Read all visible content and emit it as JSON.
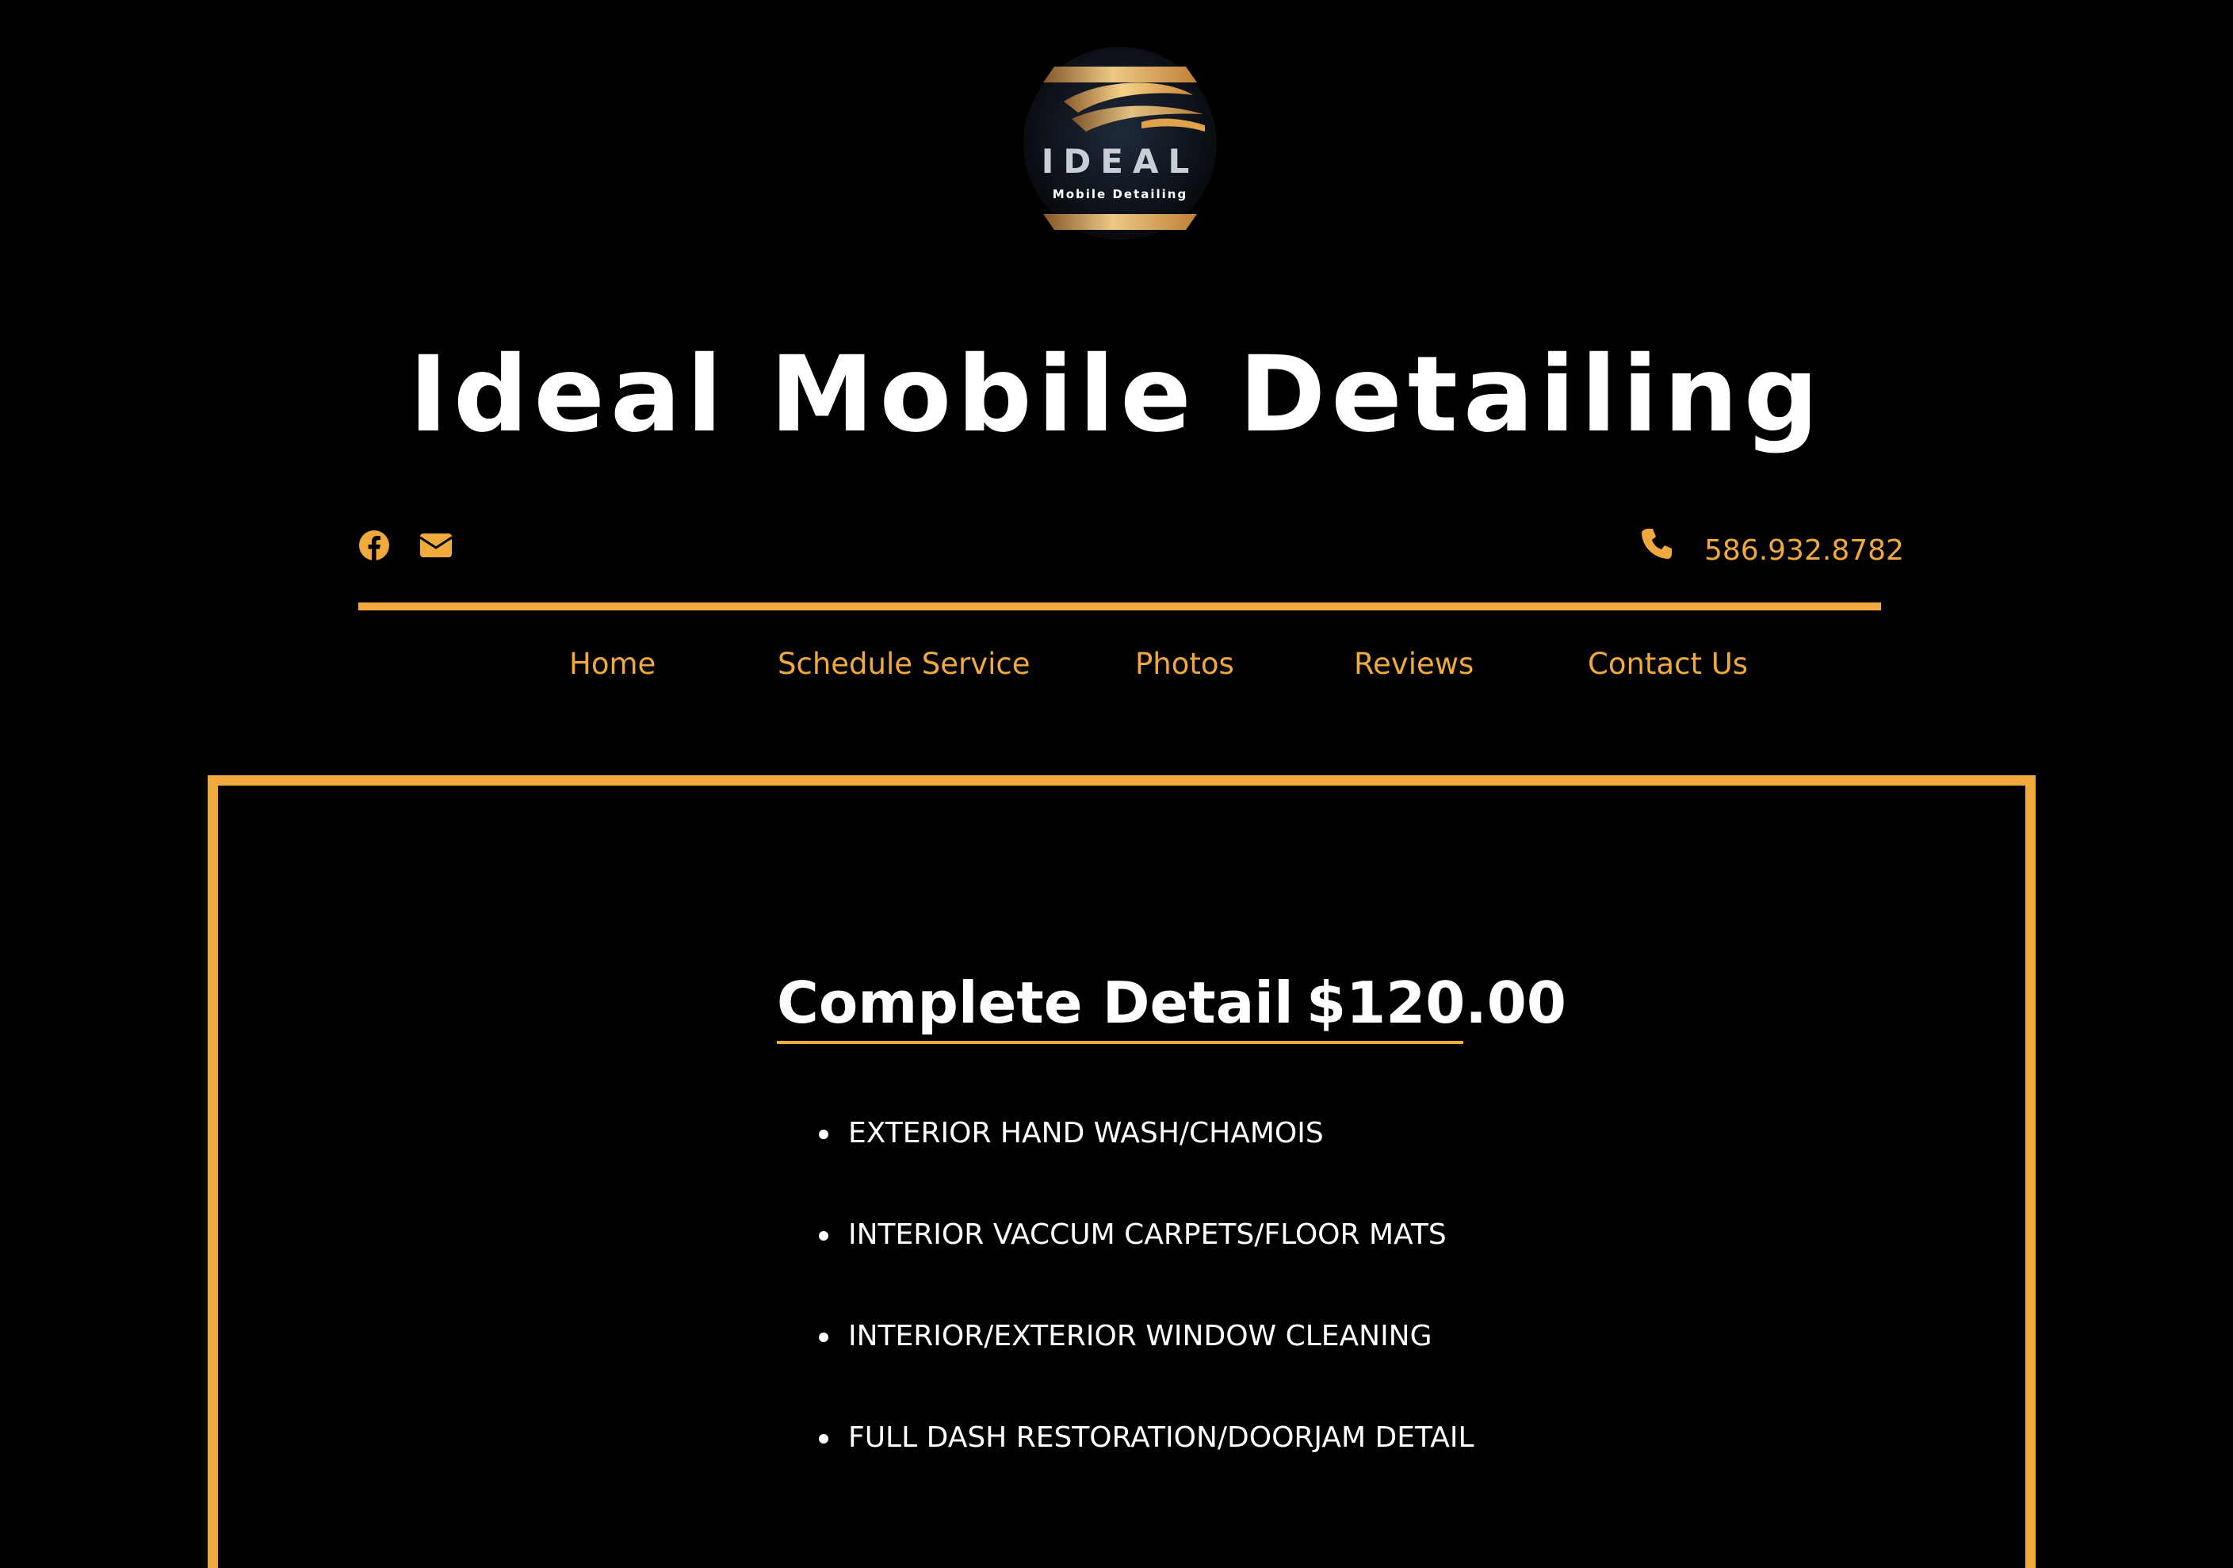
{
  "colors": {
    "background": "#000000",
    "accent": "#f0a93d",
    "text": "#ffffff"
  },
  "logo": {
    "word": "IDEAL",
    "tagline": "Mobile Detailing"
  },
  "site": {
    "title": "Ideal Mobile Detailing"
  },
  "contact": {
    "icons": [
      "facebook-icon",
      "envelope-icon",
      "phone-icon"
    ],
    "phone": "586.932.8782"
  },
  "nav": {
    "items": [
      {
        "label": "Home"
      },
      {
        "label": "Schedule Service"
      },
      {
        "label": "Photos"
      },
      {
        "label": "Reviews"
      },
      {
        "label": "Contact Us"
      }
    ]
  },
  "service": {
    "name": "Complete Detail",
    "price": "$120.00",
    "features": [
      "EXTERIOR HAND WASH/CHAMOIS",
      "INTERIOR VACCUM CARPETS/FLOOR MATS",
      "INTERIOR/EXTERIOR WINDOW CLEANING",
      "FULL DASH RESTORATION/DOORJAM DETAIL"
    ]
  }
}
